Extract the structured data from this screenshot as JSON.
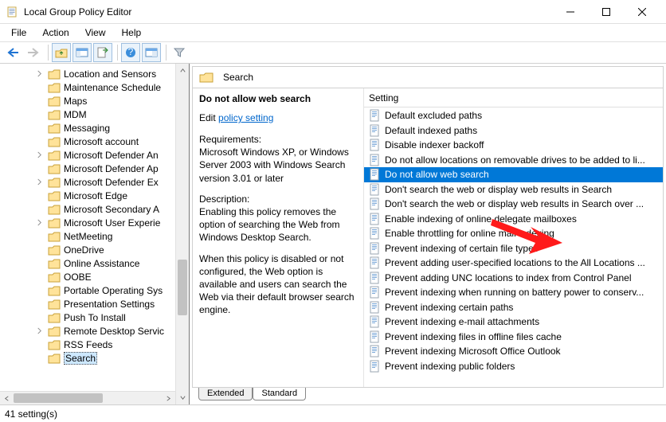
{
  "window": {
    "title": "Local Group Policy Editor"
  },
  "menu": {
    "file": "File",
    "action": "Action",
    "view": "View",
    "help": "Help"
  },
  "crumb": {
    "label": "Search"
  },
  "tree": {
    "items": [
      {
        "label": "Location and Sensors",
        "expander": true
      },
      {
        "label": "Maintenance Schedule",
        "expander": false
      },
      {
        "label": "Maps",
        "expander": false
      },
      {
        "label": "MDM",
        "expander": false
      },
      {
        "label": "Messaging",
        "expander": false
      },
      {
        "label": "Microsoft account",
        "expander": false
      },
      {
        "label": "Microsoft Defender An",
        "expander": true
      },
      {
        "label": "Microsoft Defender Ap",
        "expander": false
      },
      {
        "label": "Microsoft Defender Ex",
        "expander": true
      },
      {
        "label": "Microsoft Edge",
        "expander": false
      },
      {
        "label": "Microsoft Secondary A",
        "expander": false
      },
      {
        "label": "Microsoft User Experie",
        "expander": true
      },
      {
        "label": "NetMeeting",
        "expander": false
      },
      {
        "label": "OneDrive",
        "expander": false
      },
      {
        "label": "Online Assistance",
        "expander": false
      },
      {
        "label": "OOBE",
        "expander": false
      },
      {
        "label": "Portable Operating Sys",
        "expander": false
      },
      {
        "label": "Presentation Settings",
        "expander": false
      },
      {
        "label": "Push To Install",
        "expander": false
      },
      {
        "label": "Remote Desktop Servic",
        "expander": true
      },
      {
        "label": "RSS Feeds",
        "expander": false
      },
      {
        "label": "Search",
        "expander": false,
        "selected": true
      }
    ]
  },
  "desc": {
    "heading": "Do not allow web search",
    "edit_prefix": "Edit",
    "edit_link": "policy setting ",
    "req_label": "Requirements:",
    "req_body": "Microsoft Windows XP, or Windows Server 2003 with Windows Search version 3.01 or later",
    "desc_label": "Description:",
    "desc_body1": "Enabling this policy removes the option of searching the Web from Windows Desktop Search.",
    "desc_body2": "When this policy is disabled or not configured, the Web option is available and users can search the Web via their default browser search engine."
  },
  "list": {
    "header": "Setting",
    "rows": [
      "Default excluded paths",
      "Default indexed paths",
      "Disable indexer backoff",
      "Do not allow locations on removable drives to be added to li...",
      "Do not allow web search",
      "Don't search the web or display web results in Search",
      "Don't search the web or display web results in Search over ...",
      "Enable indexing of online delegate mailboxes",
      "Enable throttling for online mail indexing",
      "Prevent indexing of certain file types",
      "Prevent adding user-specified locations to the All Locations ...",
      "Prevent adding UNC locations to index from Control Panel",
      "Prevent indexing when running on battery power to conserv...",
      "Prevent indexing certain paths",
      "Prevent indexing e-mail attachments",
      "Prevent indexing files in offline files cache",
      "Prevent indexing Microsoft Office Outlook",
      "Prevent indexing public folders"
    ],
    "selected_index": 4
  },
  "tabs": {
    "extended": "Extended",
    "standard": "Standard"
  },
  "status": {
    "text": "41 setting(s)"
  }
}
